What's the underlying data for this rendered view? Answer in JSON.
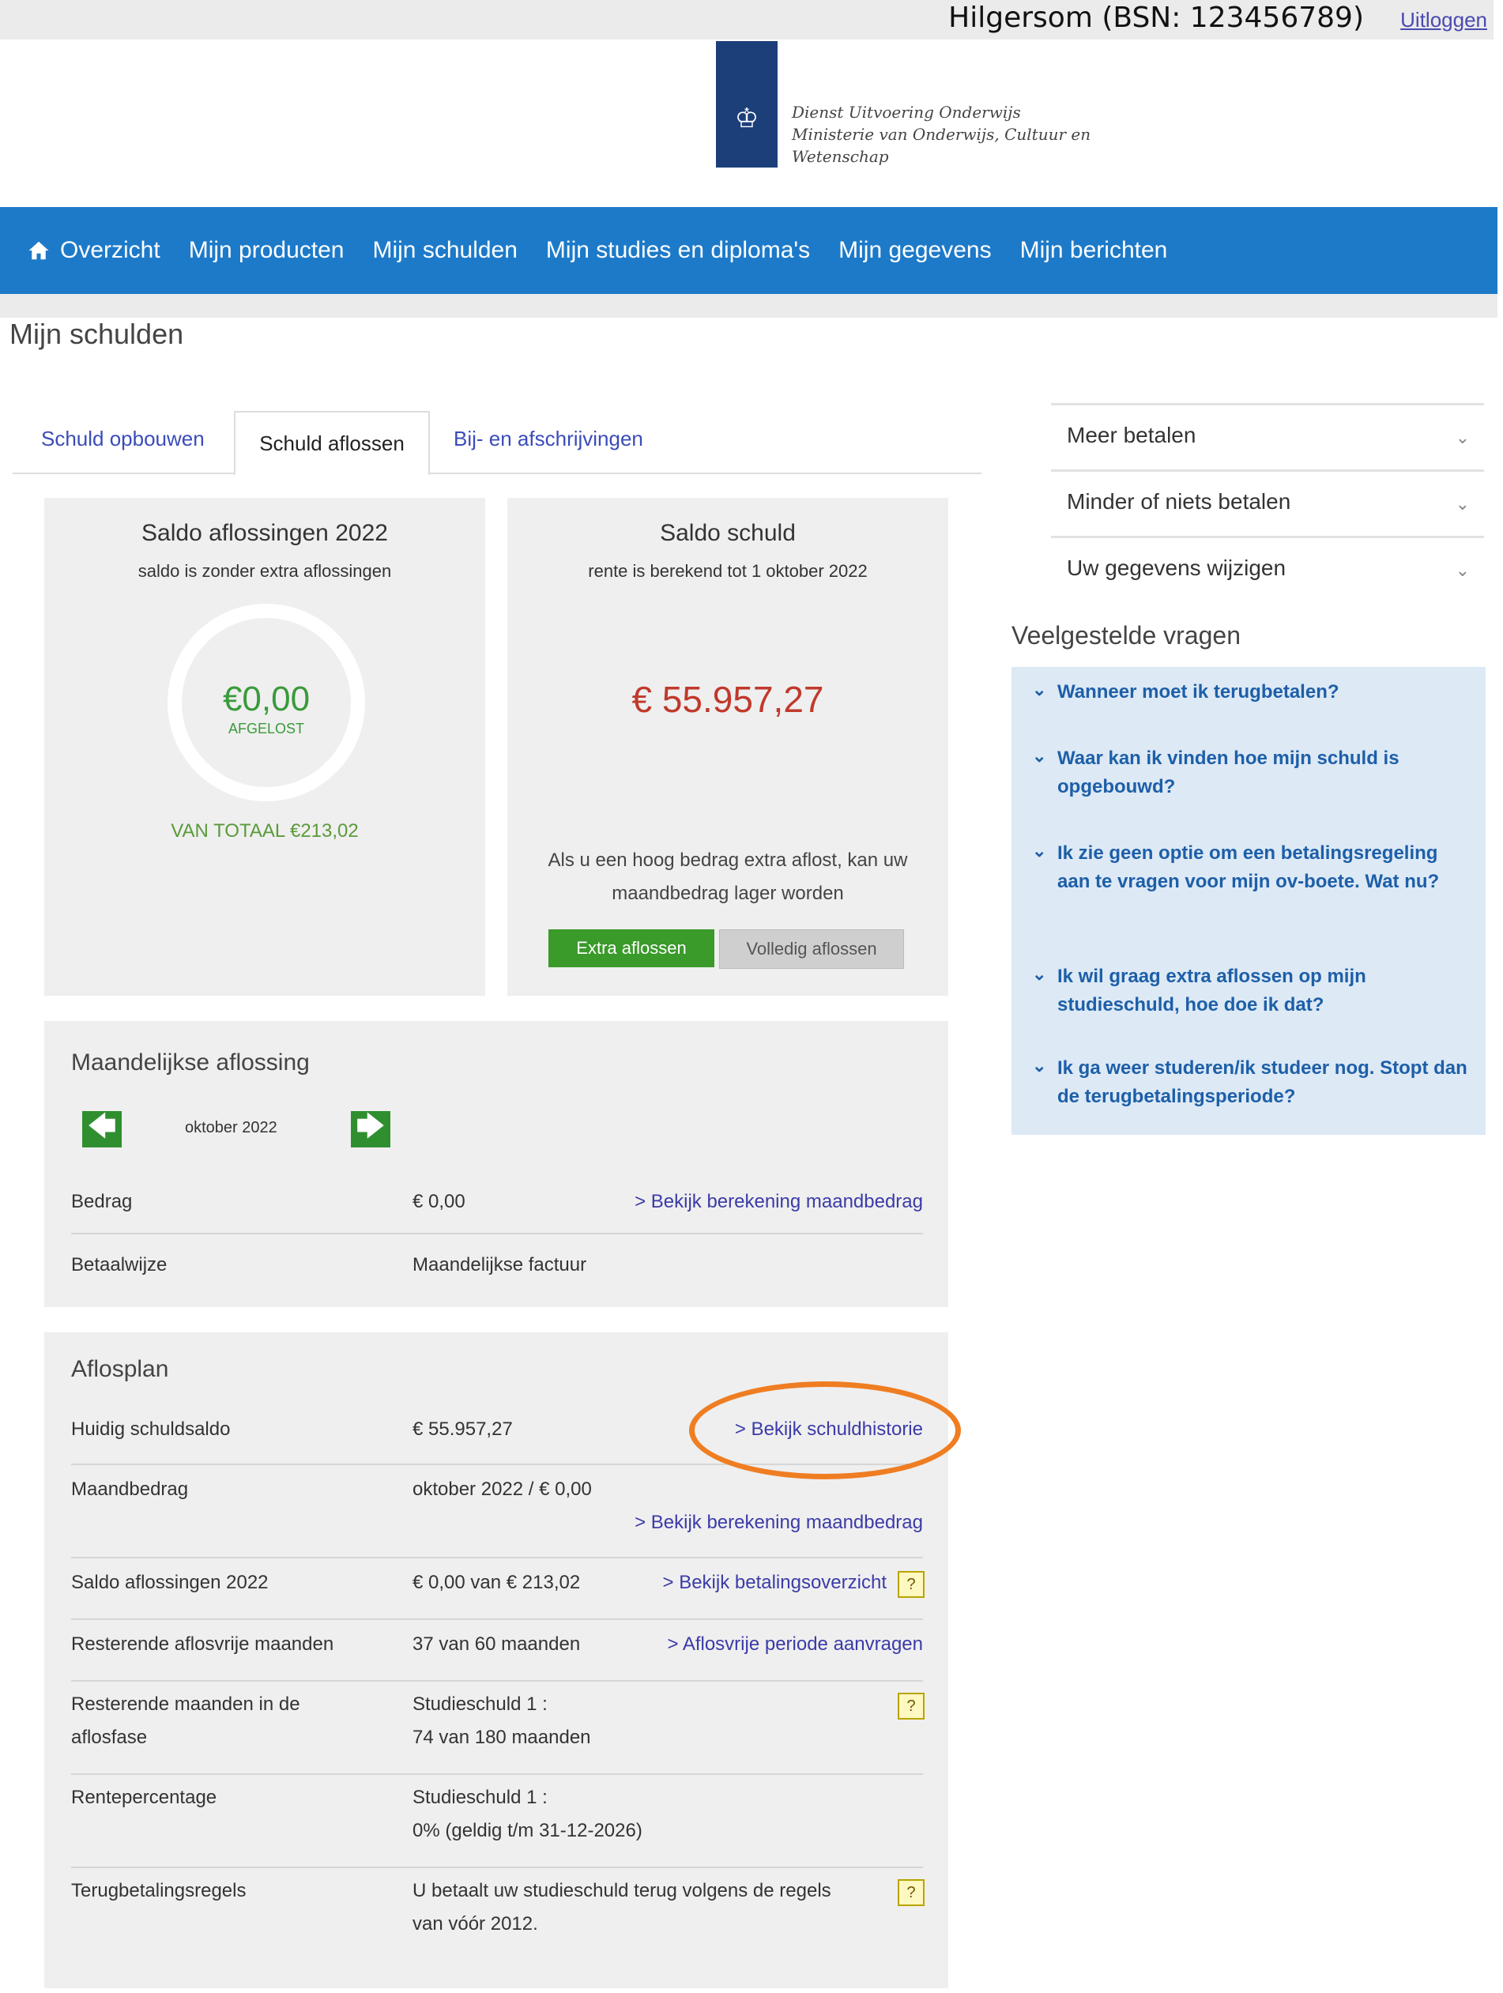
{
  "user": {
    "name": "Hilgersom (BSN: 123456789)",
    "logout_label": "Uitloggen"
  },
  "logo": {
    "text_line1": "Dienst Uitvoering Onderwijs",
    "text_line2": "Ministerie van Onderwijs, Cultuur en",
    "text_line3": "Wetenschap"
  },
  "nav": {
    "items": [
      "Overzicht",
      "Mijn producten",
      "Mijn schulden",
      "Mijn studies en diploma's",
      "Mijn gegevens",
      "Mijn berichten"
    ]
  },
  "page": {
    "title": "Mijn schulden"
  },
  "tabs": [
    "Schuld opbouwen",
    "Schuld aflossen",
    "Bij- en afschrijvingen"
  ],
  "saldo_aflossingen": {
    "title": "Saldo aflossingen 2022",
    "subtitle": "saldo is zonder extra aflossingen",
    "amount": "€0,00",
    "amount_label": "AFGELOST",
    "total": "VAN TOTAAL €213,02",
    "fraction_paid": 0
  },
  "saldo_schuld": {
    "title": "Saldo schuld",
    "subtitle": "rente is berekend tot 1 oktober 2022",
    "amount": "€ 55.957,27",
    "hint": "Als u een hoog bedrag extra aflost, kan uw maandbedrag lager worden",
    "btn_extra": "Extra aflossen",
    "btn_full": "Volledig aflossen"
  },
  "monthly": {
    "title": "Maandelijkse aflossing",
    "month": "oktober 2022",
    "rows": [
      {
        "label": "Bedrag",
        "value": "€ 0,00",
        "link": "> Bekijk berekening maandbedrag"
      },
      {
        "label": "Betaalwijze",
        "value": "Maandelijkse factuur"
      }
    ]
  },
  "plan": {
    "title": "Aflosplan",
    "rows": [
      {
        "label": "Huidig schuldsaldo",
        "value": "€ 55.957,27",
        "link": "> Bekijk schuldhistorie"
      },
      {
        "label": "Maandbedrag",
        "value": "oktober 2022 / € 0,00",
        "link": "> Bekijk berekening maandbedrag"
      },
      {
        "label": "Saldo aflossingen 2022",
        "value": "€ 0,00 van € 213,02",
        "link": "> Bekijk betalingsoverzicht"
      },
      {
        "label": "Resterende aflosvrije maanden",
        "value": "37 van 60 maanden",
        "link": "> Aflosvrije periode aanvragen"
      },
      {
        "label_1": "Resterende maanden in de",
        "label_2": "aflosfase",
        "value_1": "Studieschuld 1 :",
        "value_2": "74 van 180 maanden"
      },
      {
        "label": "Rentepercentage",
        "value_1": "Studieschuld 1 :",
        "value_2": "0% (geldig t/m 31-12-2026)"
      },
      {
        "label": "Terugbetalingsregels",
        "value_1": "U betaalt uw studieschuld terug volgens de regels",
        "value_2": "van vóór 2012."
      }
    ],
    "help_glyph": "?"
  },
  "right": {
    "accordion": [
      "Meer betalen",
      "Minder of niets betalen",
      "Uw gegevens wijzigen"
    ],
    "faq_title": "Veelgestelde vragen",
    "faq": [
      "Wanneer moet ik terugbetalen?",
      "Waar kan ik vinden hoe mijn schuld is opgebouwd?",
      "Ik zie geen optie om een betalingsregeling aan te vragen voor mijn ov-boete. Wat nu?",
      "Ik wil graag extra aflossen op mijn studieschuld, hoe doe ik dat?",
      "Ik ga weer studeren/ik studeer nog. Stopt dan de terugbetalingsperiode?"
    ]
  },
  "colors": {
    "nav_bg": "#1d7ac9",
    "accent_green": "#3a9a2a",
    "debt_red": "#c0392b",
    "link_blue": "#3b3ba8",
    "highlight_orange": "#ef7d22"
  }
}
